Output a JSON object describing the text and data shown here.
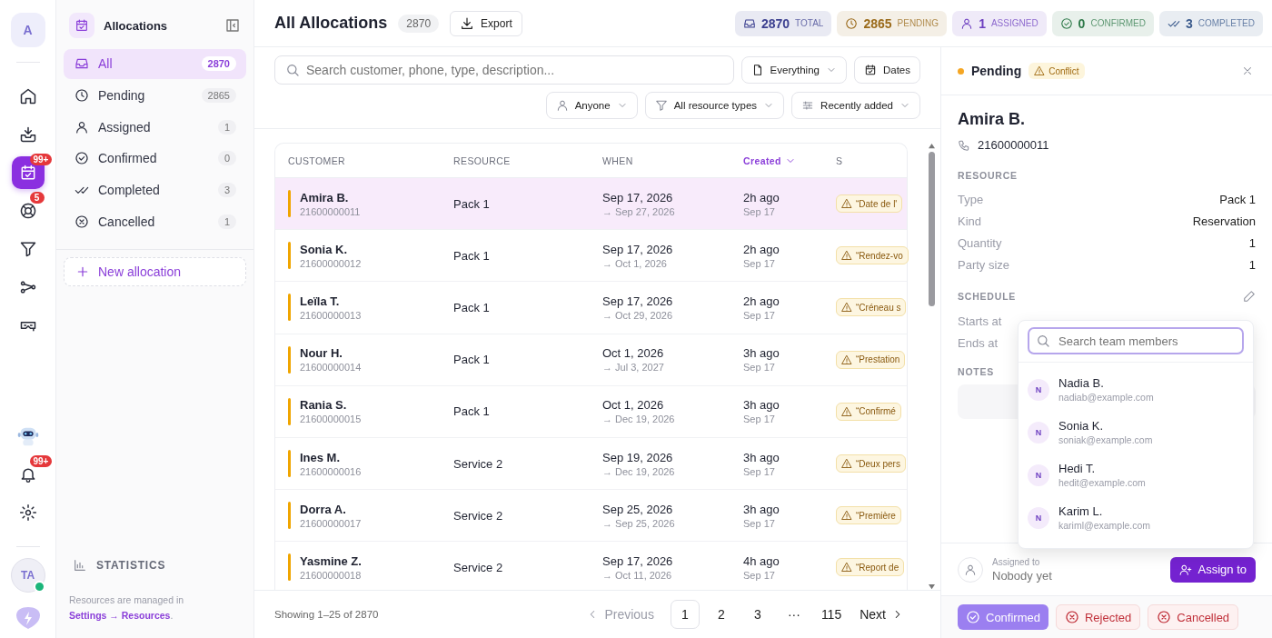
{
  "rail": {
    "logo": "A",
    "items": [
      {
        "selected": false
      },
      {
        "selected": false
      },
      {
        "selected": true,
        "badge": "99+"
      },
      {
        "selected": false,
        "badge": "5"
      },
      {
        "selected": false
      },
      {
        "selected": false
      },
      {
        "selected": false
      }
    ],
    "bottom": [
      {
        "kind": "bot"
      },
      {
        "kind": "bell",
        "badge": "99+"
      },
      {
        "kind": "settings"
      }
    ],
    "user": {
      "initials": "TA",
      "online": true
    }
  },
  "sidebar": {
    "title": "Allocations",
    "items": [
      {
        "label": "All",
        "count": "2870",
        "selected": true
      },
      {
        "label": "Pending",
        "count": "2865",
        "selected": false
      },
      {
        "label": "Assigned",
        "count": "1",
        "selected": false
      },
      {
        "label": "Confirmed",
        "count": "0",
        "selected": false
      },
      {
        "label": "Completed",
        "count": "3",
        "selected": false
      },
      {
        "label": "Cancelled",
        "count": "1",
        "selected": false
      }
    ],
    "new_button": "New allocation",
    "statistics": "STATISTICS",
    "footnote": {
      "text": "Resources are managed in",
      "link": "Settings → Resources",
      "end": "."
    }
  },
  "header": {
    "title": "All Allocations",
    "count": "2870",
    "export": "Export",
    "stats": [
      {
        "value": "2870",
        "label": "TOTAL",
        "color": "#3b3f8f"
      },
      {
        "value": "2865",
        "label": "PENDING",
        "color": "#9a6a1a"
      },
      {
        "value": "1",
        "label": "ASSIGNED",
        "color": "#6d3fc0"
      },
      {
        "value": "0",
        "label": "CONFIRMED",
        "color": "#2f7a4a"
      },
      {
        "value": "3",
        "label": "COMPLETED",
        "color": "#3a5a8c"
      }
    ]
  },
  "filters": {
    "search": {
      "placeholder": "Search customer, phone, type, description..."
    },
    "scope": "Everything",
    "dates": "Dates",
    "assignee": "Anyone",
    "type": "All resource types",
    "sort": "Recently added"
  },
  "table": {
    "columns": [
      {
        "label": "CUSTOMER",
        "sorted": false
      },
      {
        "label": "RESOURCE",
        "sorted": false
      },
      {
        "label": "WHEN",
        "sorted": false
      },
      {
        "label": "Created",
        "sorted": true
      },
      {
        "label": "S",
        "sorted": false
      }
    ],
    "rows": [
      {
        "name": "Amira B.",
        "phone": "21600000011",
        "resource": "Pack 1",
        "date": "Sep 17, 2026",
        "end": "→ Sep 27, 2026",
        "created": "2h ago",
        "created_date": "Sep 17",
        "note": "“Date de l'",
        "selected": true
      },
      {
        "name": "Sonia K.",
        "phone": "21600000012",
        "resource": "Pack 1",
        "date": "Sep 17, 2026",
        "end": "→ Oct 1, 2026",
        "created": "2h ago",
        "created_date": "Sep 17",
        "note": "“Rendez-vo",
        "selected": false
      },
      {
        "name": "Leïla T.",
        "phone": "21600000013",
        "resource": "Pack 1",
        "date": "Sep 17, 2026",
        "end": "→ Oct 29, 2026",
        "created": "2h ago",
        "created_date": "Sep 17",
        "note": "“Créneau s",
        "selected": false
      },
      {
        "name": "Nour H.",
        "phone": "21600000014",
        "resource": "Pack 1",
        "date": "Oct 1, 2026",
        "end": "→ Jul 3, 2027",
        "created": "3h ago",
        "created_date": "Sep 17",
        "note": "“Prestation",
        "selected": false
      },
      {
        "name": "Rania S.",
        "phone": "21600000015",
        "resource": "Pack 1",
        "date": "Oct 1, 2026",
        "end": "→ Dec 19, 2026",
        "created": "3h ago",
        "created_date": "Sep 17",
        "note": "“Confirmé",
        "selected": false
      },
      {
        "name": "Ines M.",
        "phone": "21600000016",
        "resource": "Service 2",
        "date": "Sep 19, 2026",
        "end": "→ Dec 19, 2026",
        "created": "3h ago",
        "created_date": "Sep 17",
        "note": "“Deux pers",
        "selected": false
      },
      {
        "name": "Dorra A.",
        "phone": "21600000017",
        "resource": "Service 2",
        "date": "Sep 25, 2026",
        "end": "→ Sep 25, 2026",
        "created": "3h ago",
        "created_date": "Sep 17",
        "note": "“Première",
        "selected": false
      },
      {
        "name": "Yasmine Z.",
        "phone": "21600000018",
        "resource": "Service 2",
        "date": "Sep 17, 2026",
        "end": "→ Oct 11, 2026",
        "created": "4h ago",
        "created_date": "Sep 17",
        "note": "“Report de",
        "selected": false
      }
    ]
  },
  "pagination": {
    "showing": "Showing 1–25 of 2870",
    "previous": {
      "label": "Previous",
      "disabled": true
    },
    "pages": [
      {
        "label": "1",
        "selected": true
      },
      {
        "label": "2",
        "selected": false
      },
      {
        "label": "3",
        "selected": false
      },
      {
        "label": "···",
        "selected": false
      },
      {
        "label": "115",
        "selected": false
      }
    ],
    "next": {
      "label": "Next",
      "disabled": false
    }
  },
  "detail": {
    "status": "Pending",
    "badge": "Conflict",
    "name": "Amira B.",
    "phone": "21600000011",
    "resource_heading": "RESOURCE",
    "fields": [
      {
        "label": "Type",
        "value": "Pack 1"
      },
      {
        "label": "Kind",
        "value": "Reservation"
      },
      {
        "label": "Quantity",
        "value": "1"
      },
      {
        "label": "Party size",
        "value": "1"
      }
    ],
    "schedule_heading": "SCHEDULE",
    "schedule": [
      {
        "label": "Starts at"
      },
      {
        "label": "Ends at"
      }
    ],
    "notes_heading": "NOTES",
    "assigned_label": "Assigned to",
    "assigned_value": "Nobody yet",
    "assign_button": "Assign to",
    "actions": [
      {
        "label": "Confirmed",
        "kind": "confirm"
      },
      {
        "label": "Rejected",
        "kind": "reject"
      },
      {
        "label": "Cancelled",
        "kind": "cancel"
      }
    ]
  },
  "popover": {
    "placeholder": "Search team members",
    "members": [
      {
        "initial": "N",
        "name": "Nadia B.",
        "email": "nadiab@example.com"
      },
      {
        "initial": "N",
        "name": "Sonia K.",
        "email": "soniak@example.com"
      },
      {
        "initial": "N",
        "name": "Hedi T.",
        "email": "hedit@example.com"
      },
      {
        "initial": "N",
        "name": "Karim L.",
        "email": "kariml@example.com"
      }
    ]
  }
}
